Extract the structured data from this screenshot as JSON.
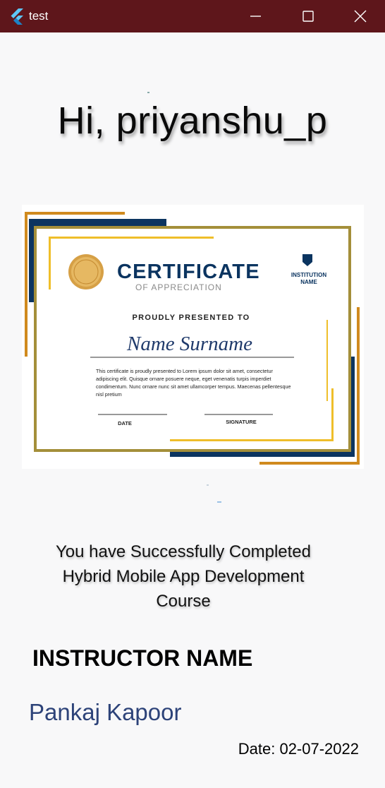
{
  "window": {
    "title": "test",
    "icon": "flutter-logo-icon",
    "controls": [
      "minimize-icon",
      "maximize-icon",
      "close-icon"
    ]
  },
  "greeting": "Hi, priyanshu_p",
  "certificate": {
    "heading": "CERTIFICATE",
    "subheading": "OF APPRECIATION",
    "institution_line1": "INSTITUTION",
    "institution_line2": "NAME",
    "presented_to": "PROUDLY  PRESENTED  TO",
    "recipient": "Name  Surname",
    "body_lines": [
      "This certificate is proudly presented to Lorem ipsum dolor sit amet, consectetur",
      "adipiscing elit. Quisque ornare posuere neque, eget venenatis turpis imperdiet",
      "condimentum. Nunc ornare nunc sit amet ullamcorper tempus. Maecenas pellentesque",
      "nisl pretium"
    ],
    "date_label": "DATE",
    "signature_label": "SIGNATURE",
    "colors": {
      "navy": "#0b3460",
      "gold": "#a48f3a",
      "yellow": "#efbe2a",
      "orange": "#d08a1e"
    }
  },
  "course_message": {
    "line1": "You have Successfully Completed",
    "line2": "Hybrid Mobile App Development",
    "line3": "Course"
  },
  "instructor": {
    "label": "INSTRUCTOR NAME",
    "name": "Pankaj Kapoor"
  },
  "date": "Date: 02-07-2022"
}
